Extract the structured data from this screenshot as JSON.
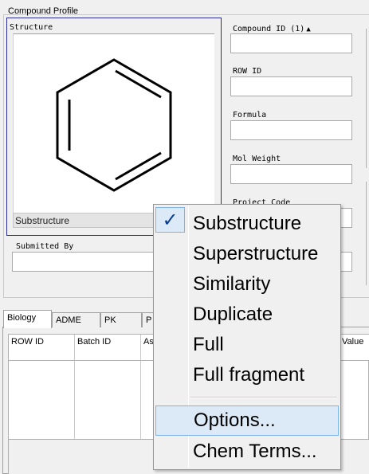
{
  "profile": {
    "group_title": "Compound Profile",
    "structure_label": "Structure",
    "search_type": "Substructure",
    "fields": {
      "compound_id_label": "Compound ID (1)",
      "row_id_label": "ROW ID",
      "formula_label": "Formula",
      "mol_weight_label": "Mol Weight",
      "project_code_label": "Project Code",
      "submitted_by_label": "Submitted By"
    }
  },
  "tabs": [
    "Biology",
    "ADME",
    "PK",
    "P"
  ],
  "grid": {
    "columns": [
      "ROW ID",
      "Batch ID",
      "As",
      "Value"
    ]
  },
  "context_menu": {
    "checked_item": "Substructure",
    "items": [
      "Substructure",
      "Superstructure",
      "Similarity",
      "Duplicate",
      "Full",
      "Full fragment"
    ],
    "extra_items": [
      "Options...",
      "Chem Terms..."
    ]
  },
  "icons": {
    "check": "check-icon",
    "sort": "sort-ascending-icon"
  },
  "colors": {
    "selection_border": "#2b2b9c",
    "menu_highlight": "#dceaf8",
    "menu_highlight_border": "#7eb4ea",
    "check": "#0b3d91"
  }
}
